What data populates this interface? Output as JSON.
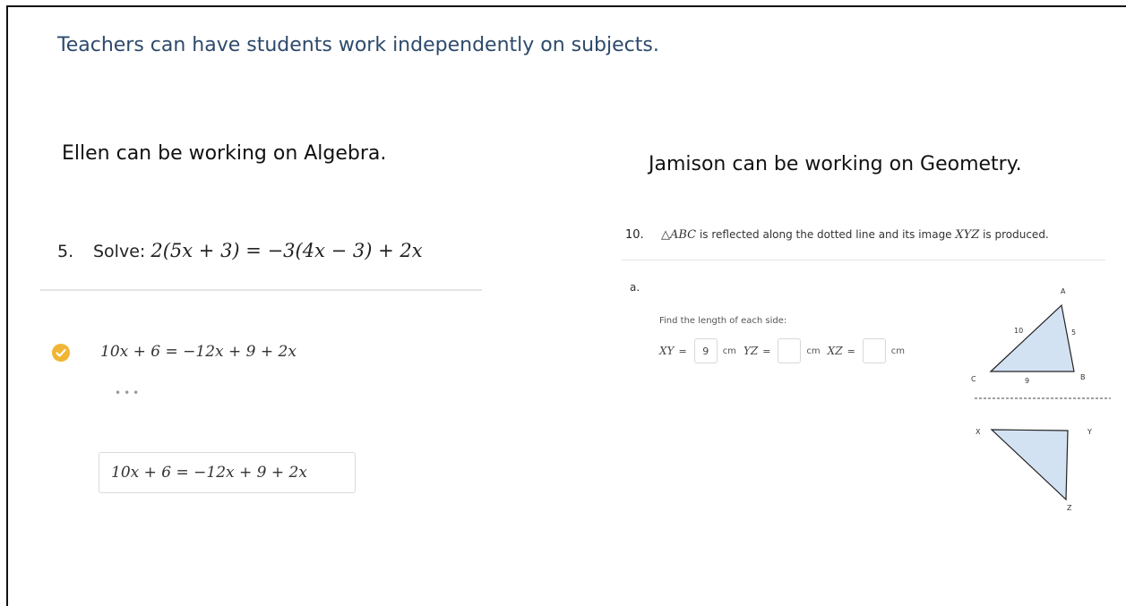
{
  "headline": "Teachers can have students work independently on subjects.",
  "left": {
    "label": "Ellen can be working on Algebra.",
    "problem_number": "5.",
    "problem_prefix": "Solve:",
    "problem_equation": "2(5x + 3) = −3(4x − 3) + 2x",
    "step": "10x + 6 = −12x + 9 + 2x",
    "ellipsis": "•••",
    "answer": "10x + 6 = −12x + 9 + 2x",
    "check_icon": "check-circle-icon",
    "check_color": "#f0b534"
  },
  "right": {
    "label": "Jamison can be working on Geometry.",
    "problem_number": "10.",
    "triangle_name": "△ABC",
    "problem_mid": " is reflected along the dotted line and its image ",
    "image_name": "XYZ",
    "problem_end": " is produced.",
    "part": "a.",
    "instruction": "Find the length of each side:",
    "measurements": [
      {
        "var": "XY",
        "value": "9",
        "unit": "cm"
      },
      {
        "var": "YZ",
        "value": "",
        "unit": "cm"
      },
      {
        "var": "XZ",
        "value": "",
        "unit": "cm"
      }
    ],
    "figure": {
      "vertices_top": {
        "a": "A",
        "b": "B",
        "c": "C"
      },
      "side_labels": {
        "ac": "10",
        "ab": "5",
        "cb": "9"
      },
      "vertices_bottom": {
        "x": "X",
        "y": "Y",
        "z": "Z"
      },
      "fill_color": "#d3e2f3"
    }
  }
}
